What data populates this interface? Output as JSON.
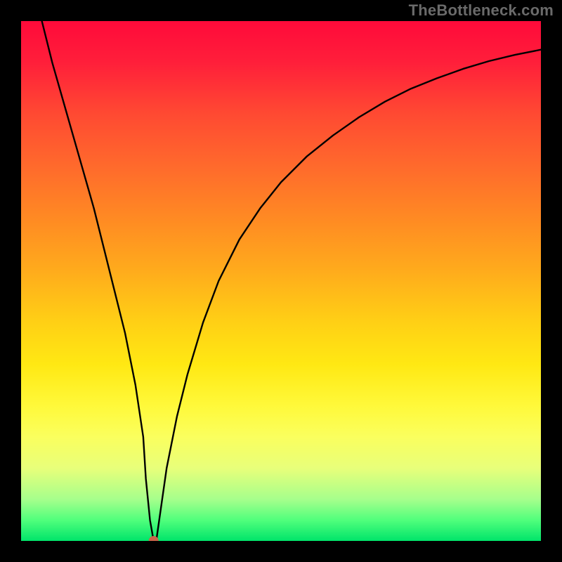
{
  "watermark": "TheBottleneck.com",
  "chart_data": {
    "type": "line",
    "title": "",
    "xlabel": "",
    "ylabel": "",
    "xlim": [
      0,
      100
    ],
    "ylim": [
      0,
      100
    ],
    "background_gradient": {
      "top": "#ff0a3a",
      "bottom": "#00e46a"
    },
    "series": [
      {
        "name": "curve",
        "color": "#000000",
        "x": [
          4,
          6,
          8,
          10,
          12,
          14,
          16,
          18,
          20,
          22,
          23.5,
          24,
          24.8,
          25.5,
          26,
          27,
          28,
          30,
          32,
          35,
          38,
          42,
          46,
          50,
          55,
          60,
          65,
          70,
          75,
          80,
          85,
          90,
          95,
          100
        ],
        "y": [
          100,
          92,
          85,
          78,
          71,
          64,
          56,
          48,
          40,
          30,
          20,
          12,
          4,
          0,
          0,
          7,
          14,
          24,
          32,
          42,
          50,
          58,
          64,
          69,
          74,
          78,
          81.5,
          84.5,
          87,
          89,
          90.8,
          92.3,
          93.5,
          94.5
        ]
      }
    ],
    "marker": {
      "name": "optimal-point",
      "x": 25.5,
      "y": 0,
      "color": "#c9634a",
      "radius_px": 7
    }
  }
}
